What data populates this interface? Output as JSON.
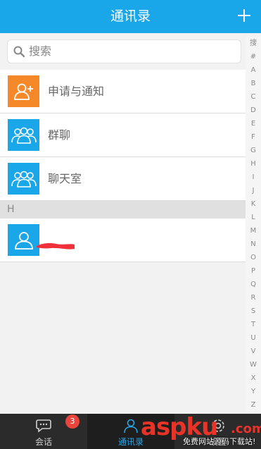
{
  "header": {
    "title": "通讯录"
  },
  "search": {
    "placeholder": "搜索"
  },
  "list": {
    "fixed_items": [
      {
        "label": "申请与通知",
        "icon": "add-person-icon",
        "color": "#f5892a"
      },
      {
        "label": "群聊",
        "icon": "group-icon",
        "color": "#1aa7ea"
      },
      {
        "label": "聊天室",
        "icon": "group-icon",
        "color": "#1aa7ea"
      }
    ],
    "section_letter": "H",
    "contact": {
      "icon": "person-icon",
      "color": "#1aa7ea"
    }
  },
  "index_bar": [
    "搜",
    "#",
    "A",
    "B",
    "C",
    "D",
    "E",
    "F",
    "G",
    "H",
    "I",
    "J",
    "K",
    "L",
    "M",
    "N",
    "O",
    "P",
    "Q",
    "R",
    "S",
    "T",
    "U",
    "V",
    "W",
    "X",
    "Y",
    "Z"
  ],
  "tabs": [
    {
      "label": "会话",
      "icon": "chat-icon",
      "badge": "3",
      "active": false
    },
    {
      "label": "通讯录",
      "icon": "contacts-icon",
      "active": true
    },
    {
      "label": "设置",
      "icon": "settings-icon",
      "active": false
    }
  ],
  "colors": {
    "primary": "#1aa7ea",
    "accent_orange": "#f5892a",
    "badge_red": "#e8453c",
    "tabbar": "#2b2b2b"
  },
  "watermark": {
    "brand": "aspku",
    "domain_suffix": ".com",
    "slogan": "免费网站源码下载站!"
  }
}
